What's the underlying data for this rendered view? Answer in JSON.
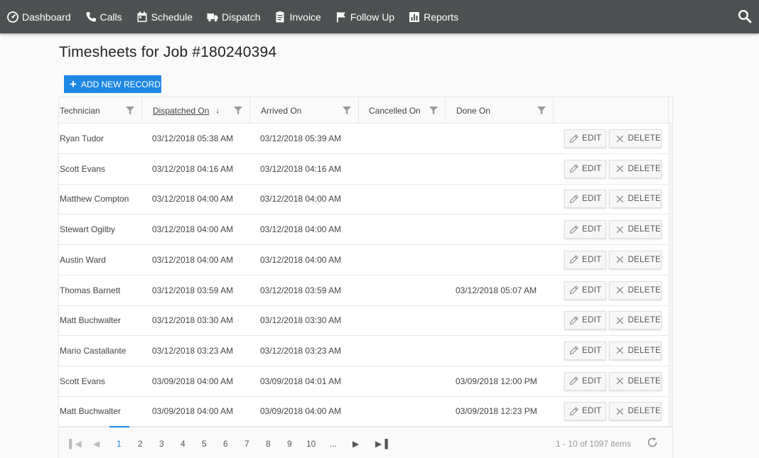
{
  "nav": {
    "items": [
      {
        "label": "Dashboard",
        "icon": "dashboard-icon"
      },
      {
        "label": "Calls",
        "icon": "phone-icon"
      },
      {
        "label": "Schedule",
        "icon": "calendar-icon"
      },
      {
        "label": "Dispatch",
        "icon": "truck-icon"
      },
      {
        "label": "Invoice",
        "icon": "invoice-icon"
      },
      {
        "label": "Follow Up",
        "icon": "flag-icon"
      },
      {
        "label": "Reports",
        "icon": "bar-chart-icon"
      }
    ],
    "search_icon": "search-icon"
  },
  "page": {
    "title": "Timesheets for Job #180240394",
    "add_button": "ADD NEW RECORD"
  },
  "grid": {
    "columns": [
      "Technician",
      "Dispatched On",
      "Arrived On",
      "Cancelled On",
      "Done On"
    ],
    "sort_column": "Dispatched On",
    "sort_direction": "descending",
    "edit_label": "EDIT",
    "delete_label": "DELETE",
    "rows": [
      {
        "technician": "Ryan Tudor",
        "dispatched": "03/12/2018 05:38 AM",
        "arrived": "03/12/2018 05:39 AM",
        "cancelled": "",
        "done": ""
      },
      {
        "technician": "Scott Evans",
        "dispatched": "03/12/2018 04:16 AM",
        "arrived": "03/12/2018 04:16 AM",
        "cancelled": "",
        "done": ""
      },
      {
        "technician": "Matthew Compton",
        "dispatched": "03/12/2018 04:00 AM",
        "arrived": "03/12/2018 04:00 AM",
        "cancelled": "",
        "done": ""
      },
      {
        "technician": "Stewart Ogilby",
        "dispatched": "03/12/2018 04:00 AM",
        "arrived": "03/12/2018 04:00 AM",
        "cancelled": "",
        "done": ""
      },
      {
        "technician": "Austin Ward",
        "dispatched": "03/12/2018 04:00 AM",
        "arrived": "03/12/2018 04:00 AM",
        "cancelled": "",
        "done": ""
      },
      {
        "technician": "Thomas Barnett",
        "dispatched": "03/12/2018 03:59 AM",
        "arrived": "03/12/2018 03:59 AM",
        "cancelled": "",
        "done": "03/12/2018 05:07 AM"
      },
      {
        "technician": "Matt Buchwalter",
        "dispatched": "03/12/2018 03:30 AM",
        "arrived": "03/12/2018 03:30 AM",
        "cancelled": "",
        "done": ""
      },
      {
        "technician": "Mario Castallante",
        "dispatched": "03/12/2018 03:23 AM",
        "arrived": "03/12/2018 03:23 AM",
        "cancelled": "",
        "done": ""
      },
      {
        "technician": "Scott Evans",
        "dispatched": "03/09/2018 04:00 AM",
        "arrived": "03/09/2018 04:01 AM",
        "cancelled": "",
        "done": "03/09/2018 12:00 PM"
      },
      {
        "technician": "Matt Buchwalter",
        "dispatched": "03/09/2018 04:00 AM",
        "arrived": "03/09/2018 04:00 AM",
        "cancelled": "",
        "done": "03/09/2018 12:23 PM"
      }
    ]
  },
  "pager": {
    "pages": [
      "1",
      "2",
      "3",
      "4",
      "5",
      "6",
      "7",
      "8",
      "9",
      "10",
      "..."
    ],
    "current_page": "1",
    "info": "1 - 10 of 1097 items"
  },
  "colors": {
    "nav_bg": "#4d5152",
    "accent": "#1e88e5"
  }
}
